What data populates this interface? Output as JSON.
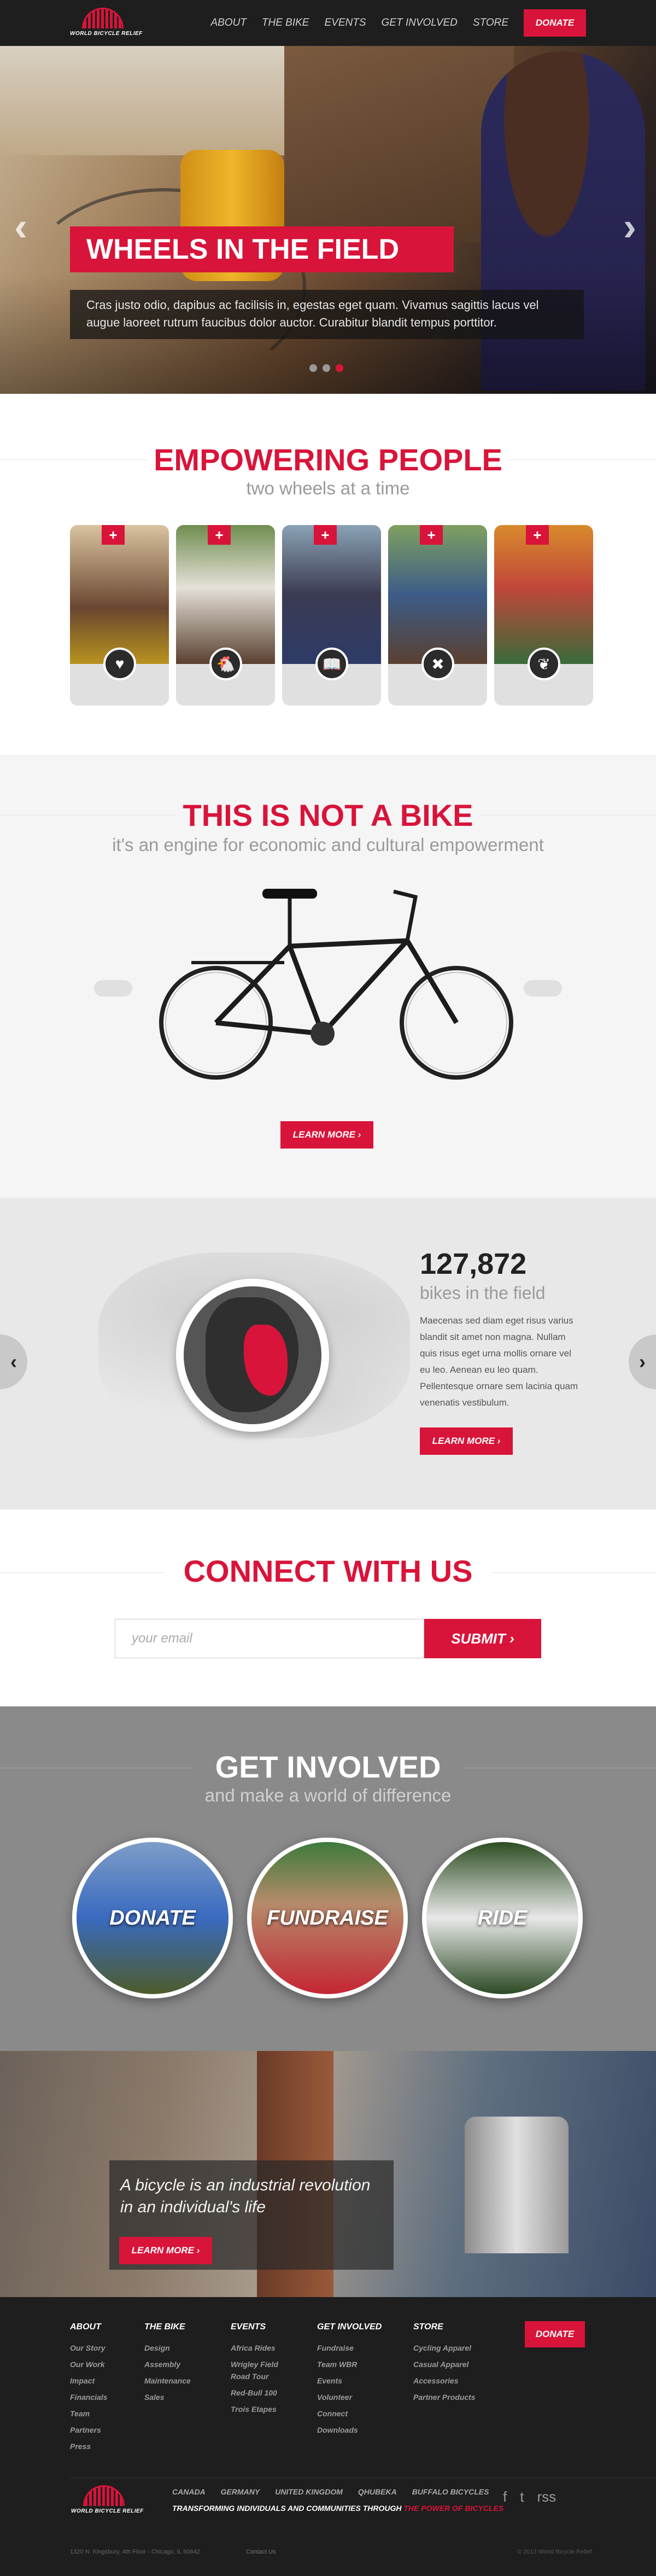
{
  "header": {
    "logo": "WORLD BICYCLE RELIEF",
    "nav": [
      "ABOUT",
      "THE BIKE",
      "EVENTS",
      "GET INVOLVED",
      "STORE"
    ],
    "donate": "DONATE"
  },
  "hero": {
    "title": "WHEELS IN THE FIELD",
    "text": "Cras justo odio, dapibus ac facilisis in, egestas eget quam. Vivamus sagittis lacus vel augue laoreet rutrum faucibus dolor auctor. Curabitur blandit tempus porttitor.",
    "prev": "‹",
    "next": "›"
  },
  "people": {
    "title": "EMPOWERING PEOPLE",
    "subtitle": "two wheels at a time",
    "cards": [
      {
        "icon": "heart-icon",
        "glyph": "♥"
      },
      {
        "icon": "chicken-icon",
        "glyph": "🐔"
      },
      {
        "icon": "book-icon",
        "glyph": "📖"
      },
      {
        "icon": "tools-icon",
        "glyph": "✖"
      },
      {
        "icon": "leaf-icon",
        "glyph": "❦"
      }
    ]
  },
  "bike": {
    "title": "THIS IS NOT A BIKE",
    "subtitle": "it's an engine for economic and cultural empowerment",
    "learn": "LEARN MORE ›"
  },
  "stats": {
    "count": "127,872",
    "label": "bikes in the field",
    "text": "Maecenas sed diam eget risus varius blandit sit amet non magna. Nullam quis risus eget urna mollis ornare vel eu leo. Aenean eu leo quam. Pellentesque ornare sem lacinia quam venenatis vestibulum.",
    "learn": "LEARN MORE ›"
  },
  "connect": {
    "title": "CONNECT WITH US",
    "placeholder": "your email",
    "submit": "SUBMIT ›"
  },
  "involved": {
    "title": "GET INVOLVED",
    "subtitle": "and make a world of difference",
    "items": [
      "DONATE",
      "FUNDRAISE",
      "RIDE"
    ]
  },
  "quote": {
    "text": "A bicycle is an industrial revolution in an individual's life",
    "learn": "LEARN MORE ›"
  },
  "footer": {
    "cols": [
      {
        "title": "ABOUT",
        "items": [
          "Our Story",
          "Our Work",
          "Impact",
          "Financials",
          "Team",
          "Partners",
          "Press"
        ]
      },
      {
        "title": "THE BIKE",
        "items": [
          "Design",
          "Assembly",
          "Maintenance",
          "Sales"
        ]
      },
      {
        "title": "EVENTS",
        "items": [
          "Africa Rides",
          "Wrigley Field Road Tour",
          "Red-Bull 100",
          "Trois Etapes"
        ]
      },
      {
        "title": "GET INVOLVED",
        "items": [
          "Fundraise",
          "Team WBR",
          "Events",
          "Volunteer",
          "Connect",
          "Downloads"
        ]
      },
      {
        "title": "STORE",
        "items": [
          "Cycling Apparel",
          "Casual Apparel",
          "Accessories",
          "Partner Products"
        ]
      }
    ],
    "donate": "DONATE",
    "countries": [
      "CANADA",
      "GERMANY",
      "UNITED KINGDOM",
      "QHUBEKA",
      "BUFFALO BICYCLES"
    ],
    "tagline": "TRANSFORMING INDIVIDUALS AND COMMUNITIES THROUGH",
    "tagline_red": "THE POWER OF BICYCLES",
    "address": "1320 N. Kingsbury, 4th Floor - Chicago, IL 60642",
    "contact": "Contact Us",
    "copyright": "© 2013 World Bicycle Relief",
    "social": [
      "f",
      "t",
      "rss"
    ]
  }
}
